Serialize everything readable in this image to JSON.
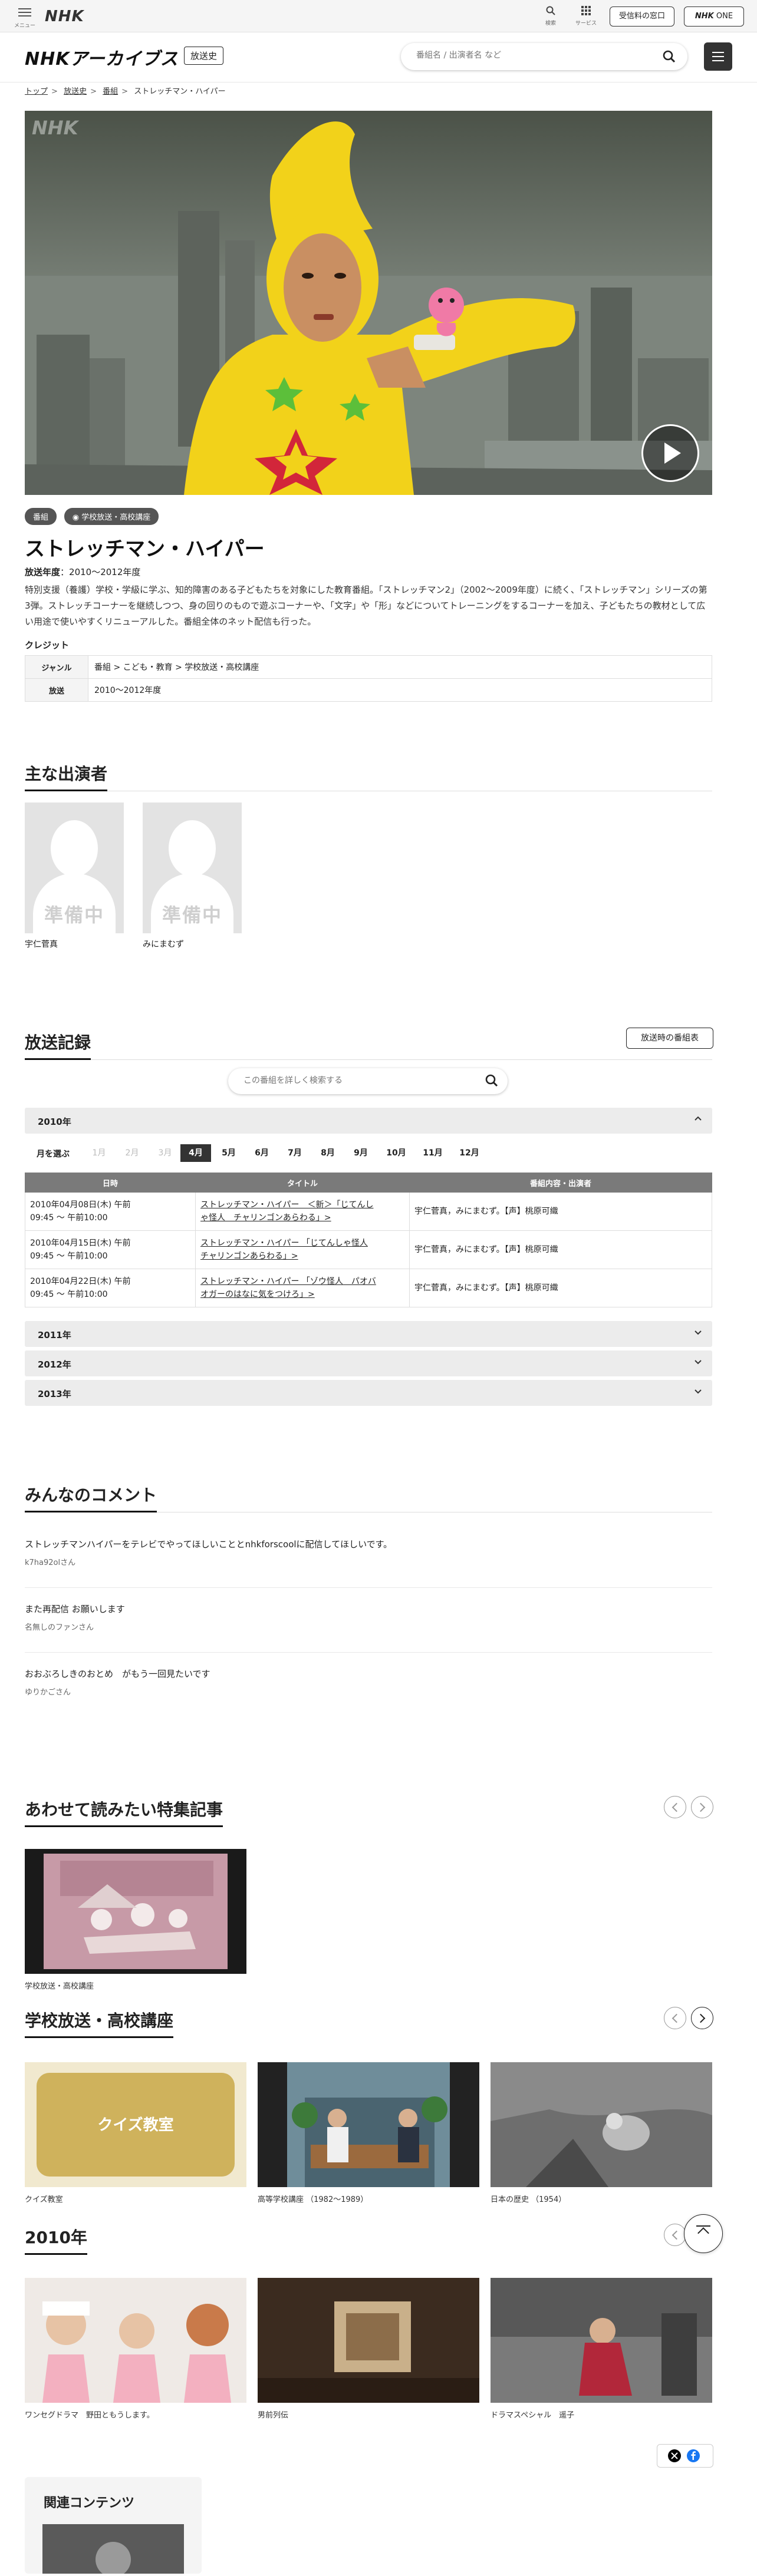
{
  "topbar": {
    "menu_label": "メニュー",
    "logo": "NHK",
    "search_label": "検索",
    "services_label": "サービス",
    "fee_label": "受信料の窓口",
    "nhkone_logo": "NHK",
    "nhkone_label": "ONE"
  },
  "header": {
    "logo": "NHKアーカイブス",
    "tag": "放送史",
    "search_placeholder": "番組名 / 出演者名 など"
  },
  "breadcrumb": [
    "トップ",
    "放送史",
    "番組",
    "ストレッチマン・ハイパー"
  ],
  "program": {
    "tags": [
      "番組",
      "学校放送・高校講座"
    ],
    "title": "ストレッチマン・ハイパー",
    "year_label": "放送年度",
    "year_value": "2010〜2012年度",
    "description": "特別支援（養護）学校・学級に学ぶ、知的障害のある子どもたちを対象にした教育番組。「ストレッチマン2」（2002〜2009年度）に続く、「ストレッチマン」シリーズの第3弾。ストレッチコーナーを継続しつつ、身の回りのもので遊ぶコーナーや、「文字」や「形」などについてトレーニングをするコーナーを加え、子どもたちの教材として広い用途で使いやすくリニューアルした。番組全体のネット配信も行った。",
    "credit_label": "クレジット",
    "credits": [
      {
        "key": "ジャンル",
        "value": "番組 > こども・教育 > 学校放送・高校講座"
      },
      {
        "key": "放送",
        "value": "2010〜2012年度"
      }
    ]
  },
  "performers": {
    "title": "主な出演者",
    "placeholder": "準備中",
    "items": [
      "宇仁菅真",
      "みにまむず"
    ]
  },
  "broadcast": {
    "title": "放送記録",
    "schedule_button": "放送時の番組表",
    "search_placeholder": "この番組を詳しく検索する",
    "open_year": "2010年",
    "month_label": "月を選ぶ",
    "months": [
      "1月",
      "2月",
      "3月",
      "4月",
      "5月",
      "6月",
      "7月",
      "8月",
      "9月",
      "10月",
      "11月",
      "12月"
    ],
    "active_month": "4月",
    "columns": [
      "日時",
      "タイトル",
      "番組内容・出演者"
    ],
    "rows": [
      {
        "date": "2010年04月08日(木) 午前",
        "time": "09:45 〜 午前10:00",
        "title_1": "ストレッチマン・ハイパー　＜新＞「じてんし",
        "title_2": "ゃ怪人　チャリンゴンあらわる」>",
        "cast": "宇仁菅真，みにまむず。【声】桃原可織"
      },
      {
        "date": "2010年04月15日(木) 午前",
        "time": "09:45 〜 午前10:00",
        "title_1": "ストレッチマン・ハイパー 「じてんしゃ怪人",
        "title_2": "チャリンゴンあらわる」>",
        "cast": "宇仁菅真，みにまむず。【声】桃原可織"
      },
      {
        "date": "2010年04月22日(木) 午前",
        "time": "09:45 〜 午前10:00",
        "title_1": "ストレッチマン・ハイパー 「ゾウ怪人　パオバ",
        "title_2": "オガーのはなに気をつけろ」>",
        "cast": "宇仁菅真，みにまむず。【声】桃原可織"
      }
    ],
    "other_years": [
      "2011年",
      "2012年",
      "2013年"
    ]
  },
  "comments": {
    "title": "みんなのコメント",
    "items": [
      {
        "text": "ストレッチマンハイパーをテレビでやってほしいこととnhkforscoolに配信してほしいです。",
        "user": "k7ha92olさん"
      },
      {
        "text": "また再配信 お願いします",
        "user": "名無しのファンさん"
      },
      {
        "text": "おおぶろしきのおとめ　がもう一回見たいです",
        "user": "ゆりかごさん"
      }
    ]
  },
  "features": {
    "title": "あわせて読みたい特集記事",
    "items": [
      "学校放送・高校講座"
    ]
  },
  "school": {
    "title": "学校放送・高校講座",
    "items": [
      "クイズ教室",
      "高等学校講座 （1982〜1989）",
      "日本の歴史 （1954）"
    ],
    "quiz_sign": "クイズ教室"
  },
  "year2010": {
    "title": "2010年",
    "items": [
      "ワンセグドラマ　野田ともうします。",
      "男前列伝",
      "ドラマスペシャル　遥子"
    ]
  },
  "related": {
    "title": "関連コンテンツ"
  },
  "colors": {
    "accent": "#333333",
    "hero_yellow": "#f2d21a",
    "muted_bg": "#ececec"
  }
}
